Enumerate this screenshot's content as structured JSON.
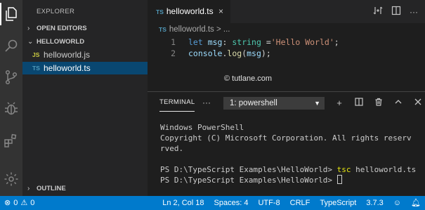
{
  "sidebar": {
    "title": "EXPLORER",
    "sections": {
      "open_editors": "OPEN EDITORS",
      "workspace": "HELLOWORLD",
      "outline": "OUTLINE"
    },
    "files": [
      {
        "badge": "JS",
        "name": "helloworld.js"
      },
      {
        "badge": "TS",
        "name": "helloworld.ts"
      }
    ]
  },
  "editor": {
    "tab": {
      "badge": "TS",
      "label": "helloworld.ts",
      "close": "×"
    },
    "breadcrumb": {
      "badge": "TS",
      "file": "helloworld.ts",
      "sep": ">",
      "more": "..."
    },
    "lines": [
      {
        "number": "1",
        "t1": "let",
        "t2": " msg",
        "t3": ": ",
        "t4": "string",
        "t5": " =",
        "t6": "'Hello World'",
        "t7": ";"
      },
      {
        "number": "2",
        "t1": "console",
        "t2": ".",
        "t3": "log",
        "t4": "(",
        "t5": "msg",
        "t6": ");"
      }
    ],
    "watermark": "© tutlane.com"
  },
  "panel": {
    "tab": "TERMINAL",
    "more": "···",
    "selected_terminal": "1: powershell",
    "terminal_lines": [
      "Windows PowerShell",
      "Copyright (C) Microsoft Corporation. All rights reserv",
      "rved.",
      "",
      "PS D:\\TypeScript Examples\\HelloWorld> ",
      "PS D:\\TypeScript Examples\\HelloWorld> "
    ],
    "command": "tsc",
    "command_arg": " helloworld.ts"
  },
  "status": {
    "errors": "0",
    "warnings": "0",
    "position": "Ln 2, Col 18",
    "spaces": "Spaces: 4",
    "encoding": "UTF-8",
    "eol": "CRLF",
    "language": "TypeScript",
    "version": "3.7.3"
  },
  "colors": {
    "status_bar": "#007acc",
    "selection": "#094771",
    "keyword": "#569cd6",
    "string": "#ce9178",
    "type": "#4ec9b0"
  }
}
